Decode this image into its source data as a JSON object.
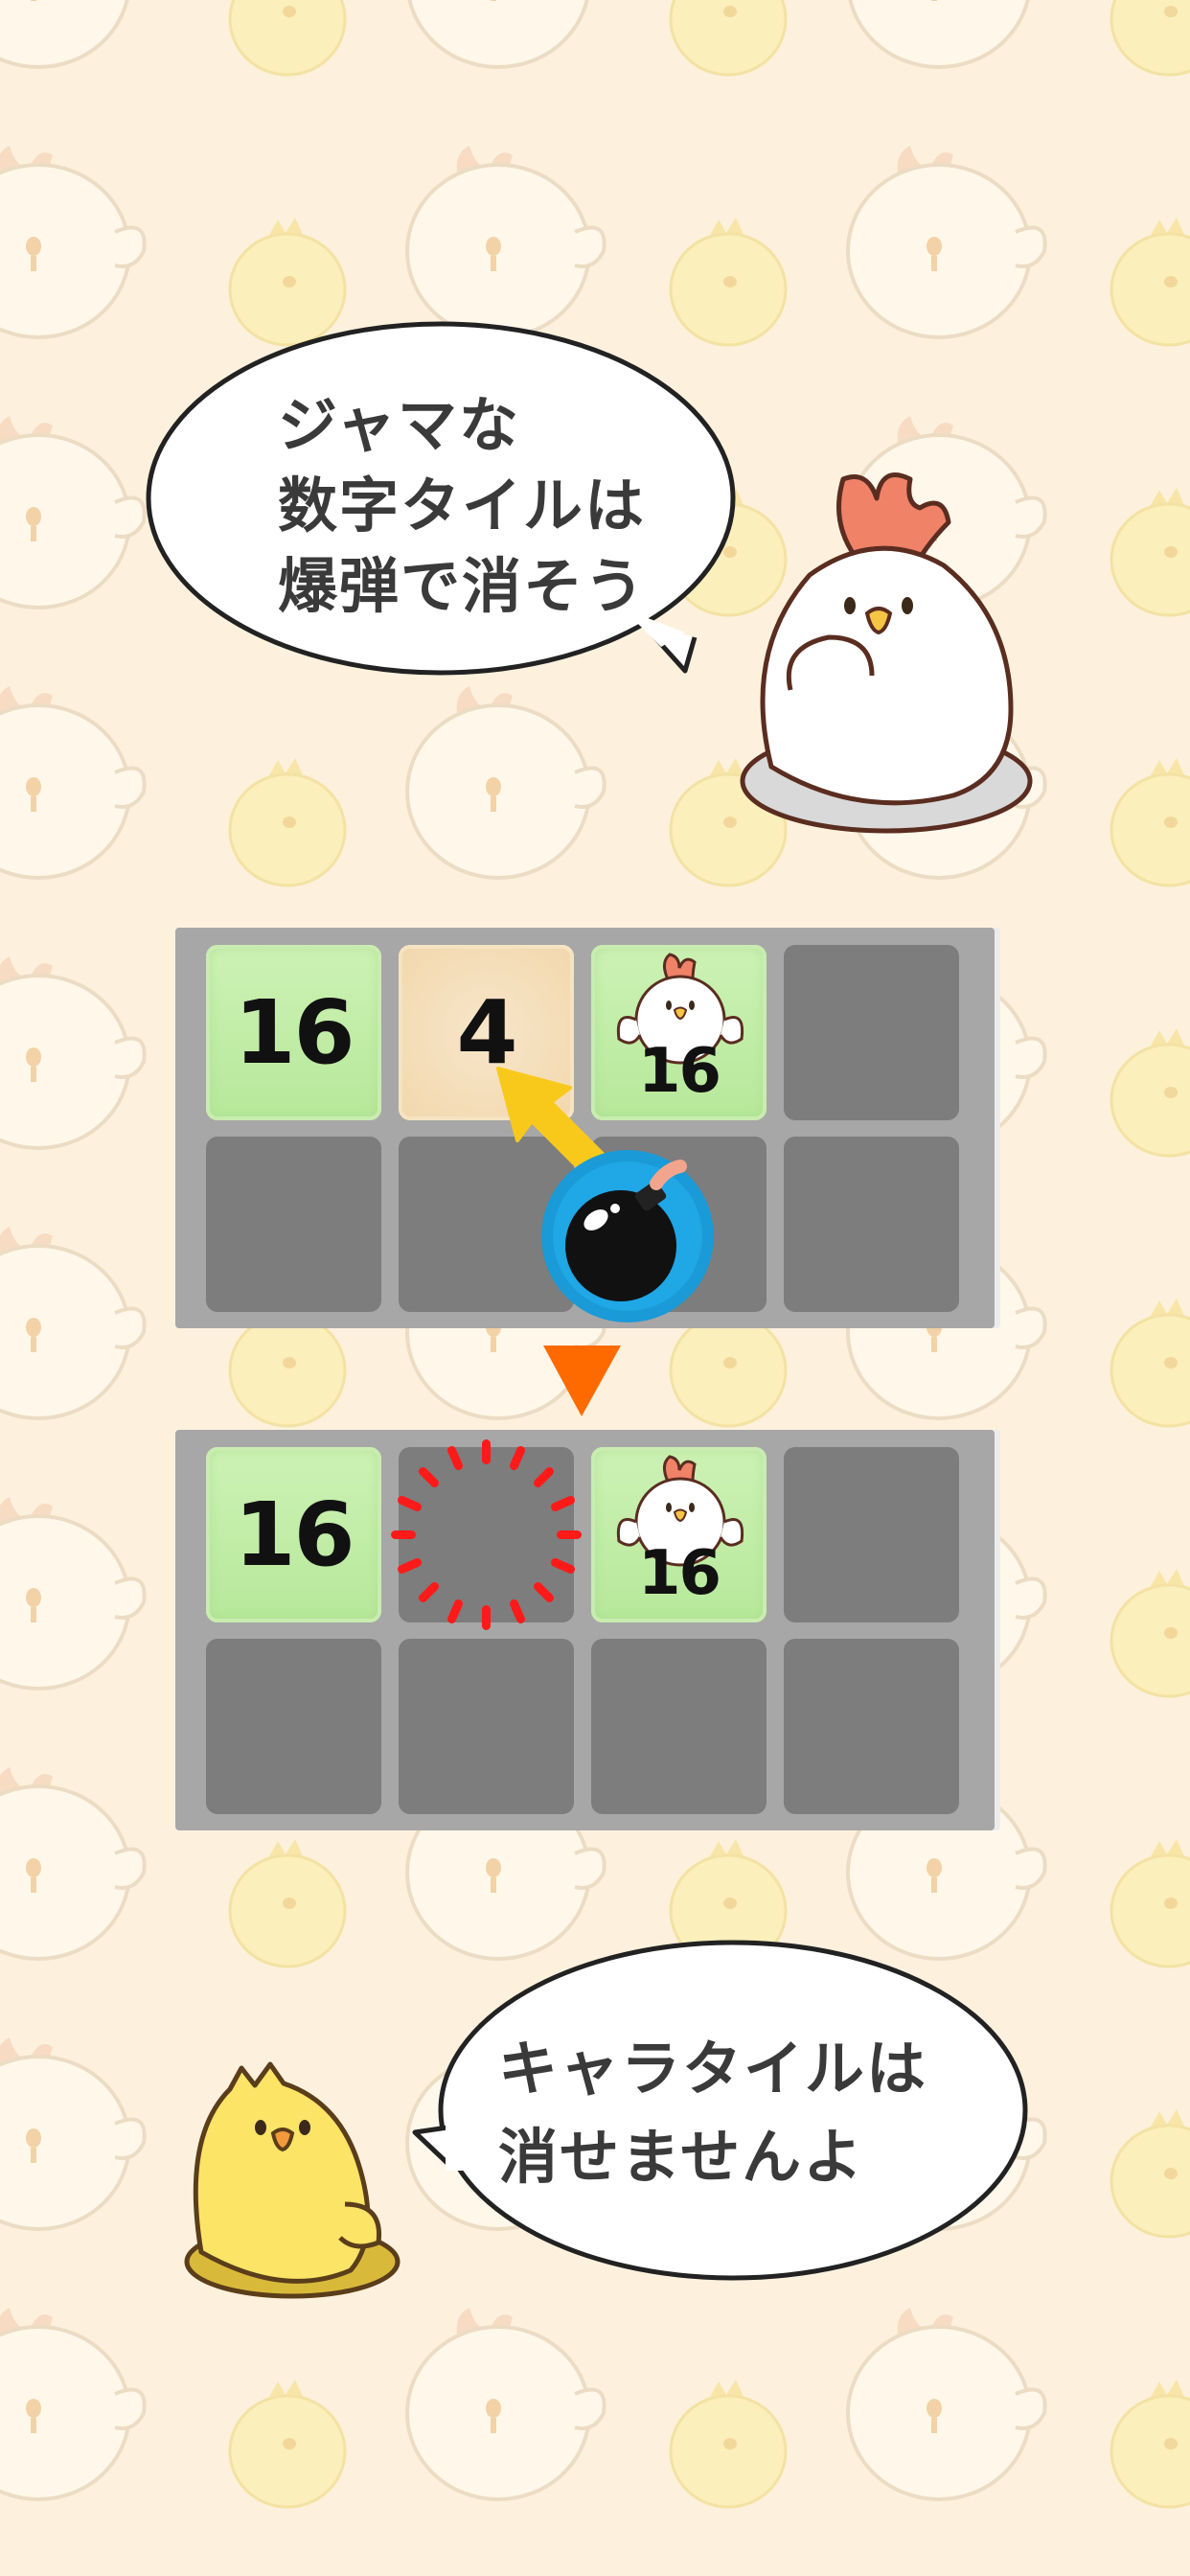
{
  "bubble_top": {
    "lines": "ジャマな\n数字タイルは\n爆弾で消そう"
  },
  "bubble_bottom": {
    "lines": "キャラタイルは\n消せませんよ"
  },
  "board_before": {
    "row1": [
      {
        "type": "number",
        "value": "16"
      },
      {
        "type": "number_cream",
        "value": "4"
      },
      {
        "type": "character",
        "value": "16"
      },
      {
        "type": "empty"
      }
    ],
    "row2": [
      {
        "type": "empty"
      },
      {
        "type": "empty"
      },
      {
        "type": "empty"
      },
      {
        "type": "empty"
      }
    ]
  },
  "board_after": {
    "row1": [
      {
        "type": "number",
        "value": "16"
      },
      {
        "type": "exploded"
      },
      {
        "type": "character",
        "value": "16"
      },
      {
        "type": "empty"
      }
    ],
    "row2": [
      {
        "type": "empty"
      },
      {
        "type": "empty"
      },
      {
        "type": "empty"
      },
      {
        "type": "empty"
      }
    ]
  },
  "colors": {
    "background": "#fdf1dd",
    "tile_green": "#c4eeaa",
    "tile_cream": "#f4ddb6",
    "board_frame": "#a7a7a7",
    "empty_cell": "#7d7d7d",
    "bomb_ring": "#1a9ad6",
    "arrow_yellow": "#f8c91b",
    "arrow_orange": "#ff6a00",
    "explosion_red": "#ff1a1a"
  },
  "icons": {
    "hen": "white-chicken-icon",
    "chick": "yellow-chick-icon",
    "bomb": "bomb-icon"
  }
}
